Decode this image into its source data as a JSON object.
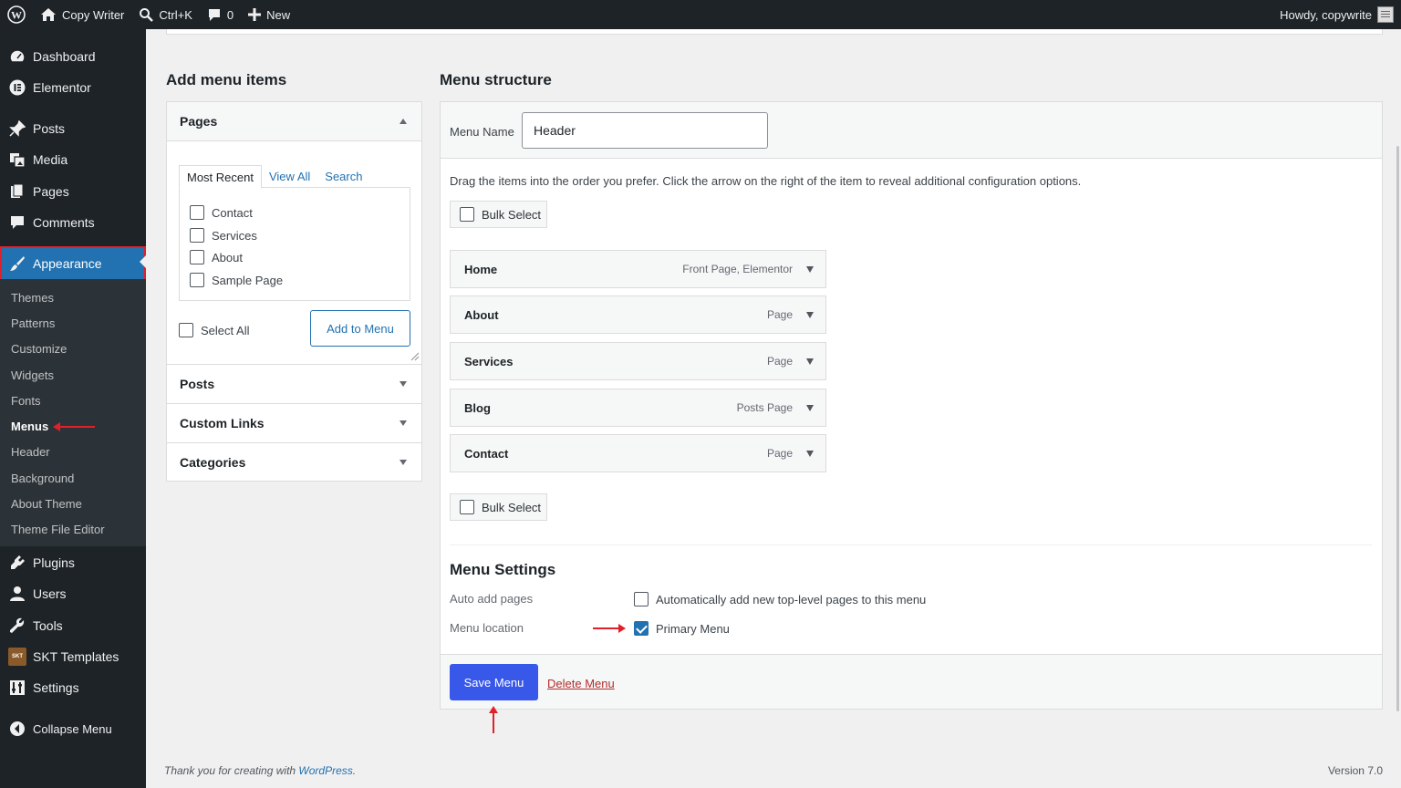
{
  "adminbar": {
    "site_name": "Copy Writer",
    "search_shortcut": "Ctrl+K",
    "comments_count": "0",
    "new_label": "New",
    "howdy": "Howdy, copywrite"
  },
  "sidebar": {
    "items": [
      {
        "label": "Dashboard",
        "icon": "dashboard-icon"
      },
      {
        "label": "Elementor",
        "icon": "elementor-icon"
      },
      {
        "label": "Posts",
        "icon": "pin-icon"
      },
      {
        "label": "Media",
        "icon": "media-icon"
      },
      {
        "label": "Pages",
        "icon": "pages-icon"
      },
      {
        "label": "Comments",
        "icon": "comment-icon"
      },
      {
        "label": "Appearance",
        "icon": "paintbrush-icon"
      },
      {
        "label": "Plugins",
        "icon": "plugin-icon"
      },
      {
        "label": "Users",
        "icon": "users-icon"
      },
      {
        "label": "Tools",
        "icon": "wrench-icon"
      },
      {
        "label": "SKT Templates",
        "icon": "skt-icon"
      },
      {
        "label": "Settings",
        "icon": "settings-icon"
      },
      {
        "label": "Collapse Menu",
        "icon": "collapse-icon"
      }
    ],
    "submenu": [
      "Themes",
      "Patterns",
      "Customize",
      "Widgets",
      "Fonts",
      "Menus",
      "Header",
      "Background",
      "About Theme",
      "Theme File Editor"
    ]
  },
  "add_items": {
    "title": "Add menu items",
    "pages_label": "Pages",
    "tabs": [
      "Most Recent",
      "View All",
      "Search"
    ],
    "pages": [
      "Contact",
      "Services",
      "About",
      "Sample Page"
    ],
    "select_all": "Select All",
    "add_button": "Add to Menu",
    "sections": [
      "Posts",
      "Custom Links",
      "Categories"
    ]
  },
  "structure": {
    "title": "Menu structure",
    "menu_name_label": "Menu Name",
    "menu_name_value": "Header",
    "instructions": "Drag the items into the order you prefer. Click the arrow on the right of the item to reveal additional configuration options.",
    "bulk_select": "Bulk Select",
    "items": [
      {
        "title": "Home",
        "type": "Front Page, Elementor"
      },
      {
        "title": "About",
        "type": "Page"
      },
      {
        "title": "Services",
        "type": "Page"
      },
      {
        "title": "Blog",
        "type": "Posts Page"
      },
      {
        "title": "Contact",
        "type": "Page"
      }
    ]
  },
  "settings": {
    "title": "Menu Settings",
    "auto_add_label": "Auto add pages",
    "auto_add_option": "Automatically add new top-level pages to this menu",
    "location_label": "Menu location",
    "location_option": "Primary Menu"
  },
  "actions": {
    "save": "Save Menu",
    "delete": "Delete Menu"
  },
  "footer": {
    "thanks_prefix": "Thank you for creating with ",
    "thanks_link": "WordPress",
    "thanks_suffix": ".",
    "version": "Version 7.0"
  },
  "colors": {
    "adminbar_bg": "#1d2327",
    "primary_button": "#3858e9",
    "highlight_red": "#e0202a",
    "link": "#2271b1"
  }
}
